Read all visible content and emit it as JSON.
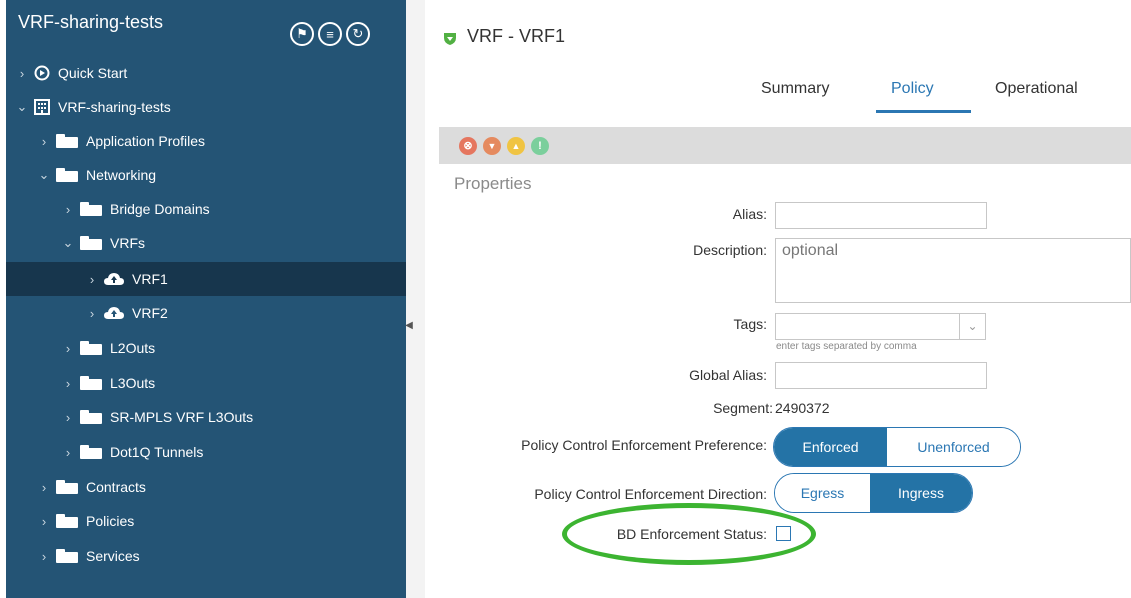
{
  "sidebar": {
    "title": "VRF-sharing-tests",
    "tools": [
      {
        "icon": "flag-icon",
        "glyph": "⚑"
      },
      {
        "icon": "list-icon",
        "glyph": "≡"
      },
      {
        "icon": "refresh-icon",
        "glyph": "↻"
      }
    ],
    "items": [
      {
        "label": "Quick Start",
        "icon": "play-icon",
        "chevron": "›",
        "expanded": false
      },
      {
        "label": "VRF-sharing-tests",
        "icon": "tenant-icon",
        "chevron": "⌄",
        "expanded": true
      },
      {
        "label": "Application Profiles",
        "icon": "folder-icon",
        "chevron": "›"
      },
      {
        "label": "Networking",
        "icon": "folder-icon",
        "chevron": "⌄"
      },
      {
        "label": "Bridge Domains",
        "icon": "folder-icon",
        "chevron": "›"
      },
      {
        "label": "VRFs",
        "icon": "folder-icon",
        "chevron": "⌄"
      },
      {
        "label": "VRF1",
        "icon": "cloud-icon",
        "chevron": "›",
        "selected": true
      },
      {
        "label": "VRF2",
        "icon": "cloud-icon",
        "chevron": "›"
      },
      {
        "label": "L2Outs",
        "icon": "folder-icon",
        "chevron": "›"
      },
      {
        "label": "L3Outs",
        "icon": "folder-icon",
        "chevron": "›"
      },
      {
        "label": "SR-MPLS VRF L3Outs",
        "icon": "folder-icon",
        "chevron": "›"
      },
      {
        "label": "Dot1Q Tunnels",
        "icon": "folder-icon",
        "chevron": "›"
      },
      {
        "label": "Contracts",
        "icon": "folder-icon",
        "chevron": "›"
      },
      {
        "label": "Policies",
        "icon": "folder-icon",
        "chevron": "›"
      },
      {
        "label": "Services",
        "icon": "folder-icon",
        "chevron": "›"
      }
    ]
  },
  "header": {
    "title": "VRF - VRF1"
  },
  "tabs": [
    {
      "label": "Summary",
      "active": false
    },
    {
      "label": "Policy",
      "active": true
    },
    {
      "label": "Operational",
      "active": false
    }
  ],
  "faults": [
    {
      "icon": "critical-fault-icon",
      "glyph": "⊗",
      "color": "#e5765f"
    },
    {
      "icon": "major-fault-icon",
      "glyph": "▼",
      "color": "#e58a5f"
    },
    {
      "icon": "minor-fault-icon",
      "glyph": "▲",
      "color": "#f0c443"
    },
    {
      "icon": "warning-fault-icon",
      "glyph": "!",
      "color": "#7bcf9c"
    }
  ],
  "properties": {
    "title": "Properties",
    "alias_label": "Alias:",
    "alias_value": "",
    "description_label": "Description:",
    "description_placeholder": "optional",
    "tags_label": "Tags:",
    "tags_hint": "enter tags separated by comma",
    "global_alias_label": "Global Alias:",
    "global_alias_value": "",
    "segment_label": "Segment:",
    "segment_value": "2490372",
    "pref_label": "Policy Control Enforcement Preference:",
    "pref_options": [
      "Enforced",
      "Unenforced"
    ],
    "pref_selected": "Enforced",
    "direction_label": "Policy Control Enforcement Direction:",
    "direction_options": [
      "Egress",
      "Ingress"
    ],
    "direction_selected": "Ingress",
    "bd_enf_label": "BD Enforcement Status:",
    "bd_enf_checked": false
  },
  "colors": {
    "sidebar_bg": "#245475",
    "selected_bg": "#17364d",
    "accent": "#2b77b3",
    "highlight": "#3cb431",
    "vrf_shield": "#52b043"
  }
}
